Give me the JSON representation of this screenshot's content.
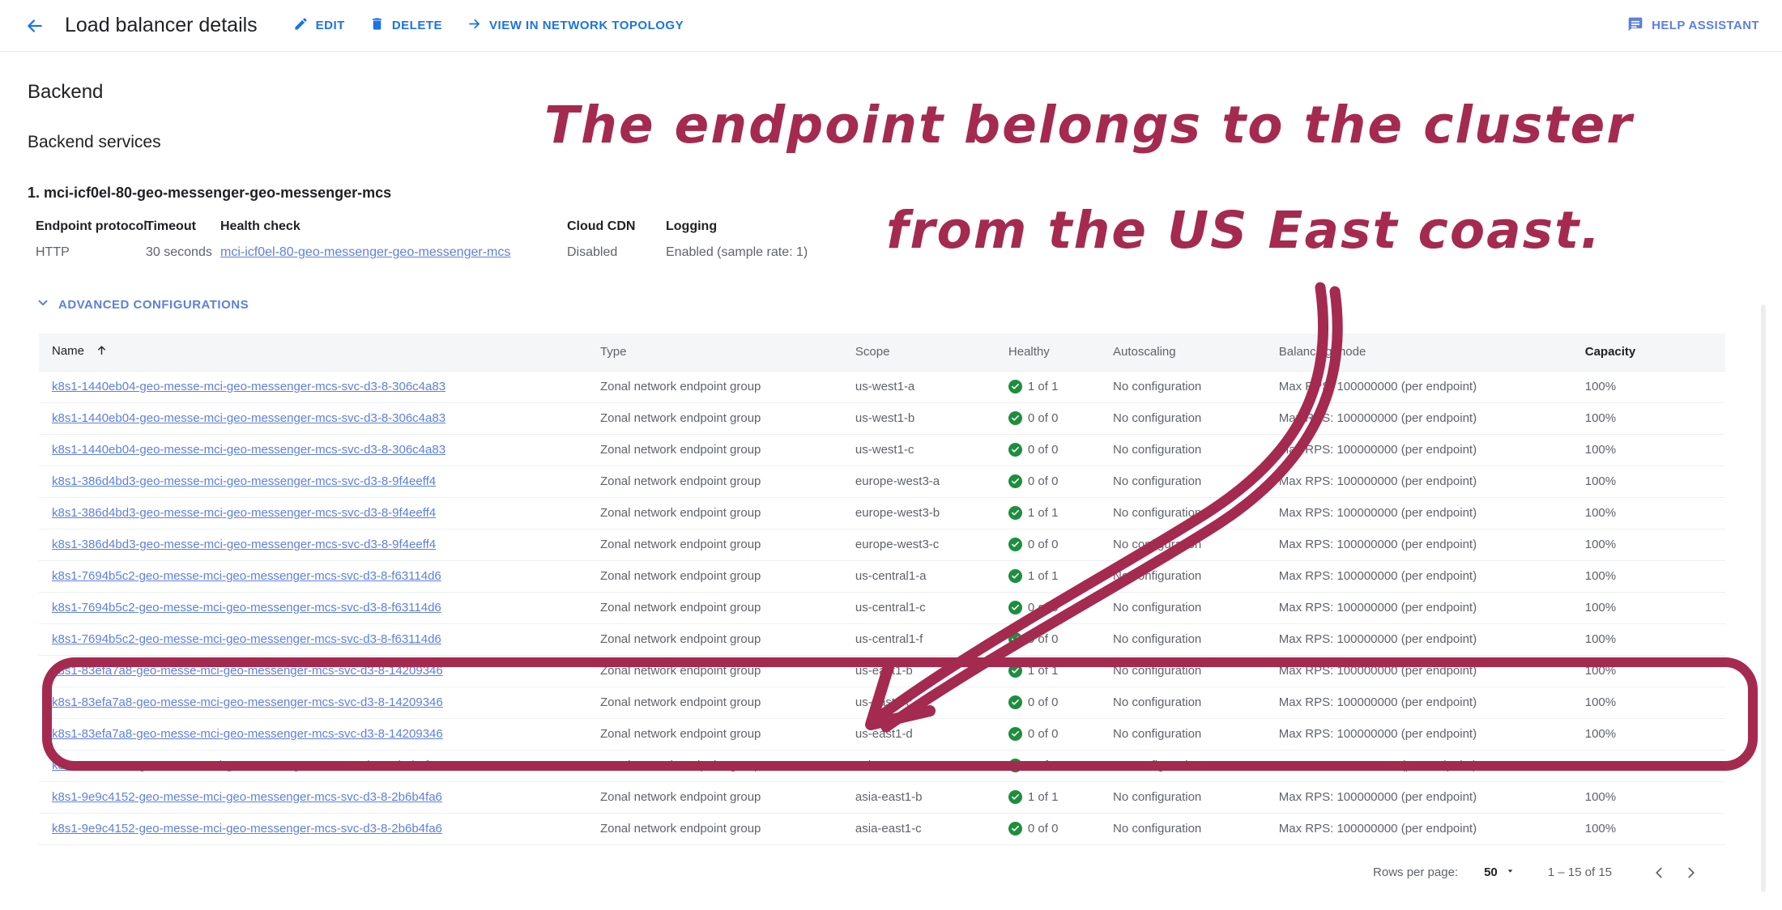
{
  "appbar": {
    "back_icon": "arrow-left-icon",
    "title": "Load balancer details",
    "actions": [
      {
        "icon": "pencil-icon",
        "label": "EDIT"
      },
      {
        "icon": "trash-icon",
        "label": "DELETE"
      },
      {
        "icon": "arrow-right-icon",
        "label": "VIEW IN NETWORK TOPOLOGY"
      }
    ],
    "help_assistant": {
      "icon": "chat-icon",
      "label": "HELP ASSISTANT"
    }
  },
  "sections": {
    "backend_heading": "Backend",
    "backend_services_heading": "Backend services",
    "service_title": "1. mci-icf0el-80-geo-messenger-geo-messenger-mcs",
    "details": [
      {
        "label": "Endpoint protocol",
        "value": "HTTP",
        "link": false
      },
      {
        "label": "Timeout",
        "value": "30 seconds",
        "link": false
      },
      {
        "label": "Health check",
        "value": "mci-icf0el-80-geo-messenger-geo-messenger-mcs",
        "link": true
      },
      {
        "label": "Cloud CDN",
        "value": "Disabled",
        "link": false
      },
      {
        "label": "Logging",
        "value": "Enabled (sample rate: 1)",
        "link": false
      }
    ],
    "advanced_configurations": "ADVANCED CONFIGURATIONS"
  },
  "table": {
    "columns": [
      "Name",
      "Type",
      "Scope",
      "Healthy",
      "Autoscaling",
      "Balancing mode",
      "Capacity"
    ],
    "sort_column": "Name",
    "sort_direction": "asc",
    "rows": [
      {
        "name": "k8s1-1440eb04-geo-messe-mci-geo-messenger-mcs-svc-d3-8-306c4a83",
        "type": "Zonal network endpoint group",
        "scope": "us-west1-a",
        "healthy": "1 of 1",
        "autoscaling": "No configuration",
        "balancing": "Max RPS: 100000000 (per endpoint)",
        "capacity": "100%"
      },
      {
        "name": "k8s1-1440eb04-geo-messe-mci-geo-messenger-mcs-svc-d3-8-306c4a83",
        "type": "Zonal network endpoint group",
        "scope": "us-west1-b",
        "healthy": "0 of 0",
        "autoscaling": "No configuration",
        "balancing": "Max RPS: 100000000 (per endpoint)",
        "capacity": "100%"
      },
      {
        "name": "k8s1-1440eb04-geo-messe-mci-geo-messenger-mcs-svc-d3-8-306c4a83",
        "type": "Zonal network endpoint group",
        "scope": "us-west1-c",
        "healthy": "0 of 0",
        "autoscaling": "No configuration",
        "balancing": "Max RPS: 100000000 (per endpoint)",
        "capacity": "100%"
      },
      {
        "name": "k8s1-386d4bd3-geo-messe-mci-geo-messenger-mcs-svc-d3-8-9f4eeff4",
        "type": "Zonal network endpoint group",
        "scope": "europe-west3-a",
        "healthy": "0 of 0",
        "autoscaling": "No configuration",
        "balancing": "Max RPS: 100000000 (per endpoint)",
        "capacity": "100%"
      },
      {
        "name": "k8s1-386d4bd3-geo-messe-mci-geo-messenger-mcs-svc-d3-8-9f4eeff4",
        "type": "Zonal network endpoint group",
        "scope": "europe-west3-b",
        "healthy": "1 of 1",
        "autoscaling": "No configuration",
        "balancing": "Max RPS: 100000000 (per endpoint)",
        "capacity": "100%"
      },
      {
        "name": "k8s1-386d4bd3-geo-messe-mci-geo-messenger-mcs-svc-d3-8-9f4eeff4",
        "type": "Zonal network endpoint group",
        "scope": "europe-west3-c",
        "healthy": "0 of 0",
        "autoscaling": "No configuration",
        "balancing": "Max RPS: 100000000 (per endpoint)",
        "capacity": "100%"
      },
      {
        "name": "k8s1-7694b5c2-geo-messe-mci-geo-messenger-mcs-svc-d3-8-f63114d6",
        "type": "Zonal network endpoint group",
        "scope": "us-central1-a",
        "healthy": "1 of 1",
        "autoscaling": "No configuration",
        "balancing": "Max RPS: 100000000 (per endpoint)",
        "capacity": "100%"
      },
      {
        "name": "k8s1-7694b5c2-geo-messe-mci-geo-messenger-mcs-svc-d3-8-f63114d6",
        "type": "Zonal network endpoint group",
        "scope": "us-central1-c",
        "healthy": "0 of 0",
        "autoscaling": "No configuration",
        "balancing": "Max RPS: 100000000 (per endpoint)",
        "capacity": "100%"
      },
      {
        "name": "k8s1-7694b5c2-geo-messe-mci-geo-messenger-mcs-svc-d3-8-f63114d6",
        "type": "Zonal network endpoint group",
        "scope": "us-central1-f",
        "healthy": "0 of 0",
        "autoscaling": "No configuration",
        "balancing": "Max RPS: 100000000 (per endpoint)",
        "capacity": "100%"
      },
      {
        "name": "k8s1-83efa7a8-geo-messe-mci-geo-messenger-mcs-svc-d3-8-14209346",
        "type": "Zonal network endpoint group",
        "scope": "us-east1-b",
        "healthy": "1 of 1",
        "autoscaling": "No configuration",
        "balancing": "Max RPS: 100000000 (per endpoint)",
        "capacity": "100%"
      },
      {
        "name": "k8s1-83efa7a8-geo-messe-mci-geo-messenger-mcs-svc-d3-8-14209346",
        "type": "Zonal network endpoint group",
        "scope": "us-east1-c",
        "healthy": "0 of 0",
        "autoscaling": "No configuration",
        "balancing": "Max RPS: 100000000 (per endpoint)",
        "capacity": "100%"
      },
      {
        "name": "k8s1-83efa7a8-geo-messe-mci-geo-messenger-mcs-svc-d3-8-14209346",
        "type": "Zonal network endpoint group",
        "scope": "us-east1-d",
        "healthy": "0 of 0",
        "autoscaling": "No configuration",
        "balancing": "Max RPS: 100000000 (per endpoint)",
        "capacity": "100%"
      },
      {
        "name": "k8s1-9e9c4152-geo-messe-mci-geo-messenger-mcs-svc-d3-8-2b6b4fa6",
        "type": "Zonal network endpoint group",
        "scope": "asia-east1-a",
        "healthy": "0 of 0",
        "autoscaling": "No configuration",
        "balancing": "Max RPS: 100000000 (per endpoint)",
        "capacity": "100%"
      },
      {
        "name": "k8s1-9e9c4152-geo-messe-mci-geo-messenger-mcs-svc-d3-8-2b6b4fa6",
        "type": "Zonal network endpoint group",
        "scope": "asia-east1-b",
        "healthy": "1 of 1",
        "autoscaling": "No configuration",
        "balancing": "Max RPS: 100000000 (per endpoint)",
        "capacity": "100%"
      },
      {
        "name": "k8s1-9e9c4152-geo-messe-mci-geo-messenger-mcs-svc-d3-8-2b6b4fa6",
        "type": "Zonal network endpoint group",
        "scope": "asia-east1-c",
        "healthy": "0 of 0",
        "autoscaling": "No configuration",
        "balancing": "Max RPS: 100000000 (per endpoint)",
        "capacity": "100%"
      }
    ]
  },
  "pagination": {
    "rows_per_page_label": "Rows per page:",
    "rows_per_page_value": "50",
    "range": "1 – 15 of 15",
    "prev_icon": "chevron-left-icon",
    "next_icon": "chevron-right-icon"
  },
  "annotation": {
    "color": "#a52a4f",
    "line1": "The endpoint belongs to the cluster",
    "line2": "from the US East coast.",
    "shapes": [
      "arrow-pointing-to-us-east1-rows",
      "highlight-box-around-us-east1-rows"
    ]
  }
}
